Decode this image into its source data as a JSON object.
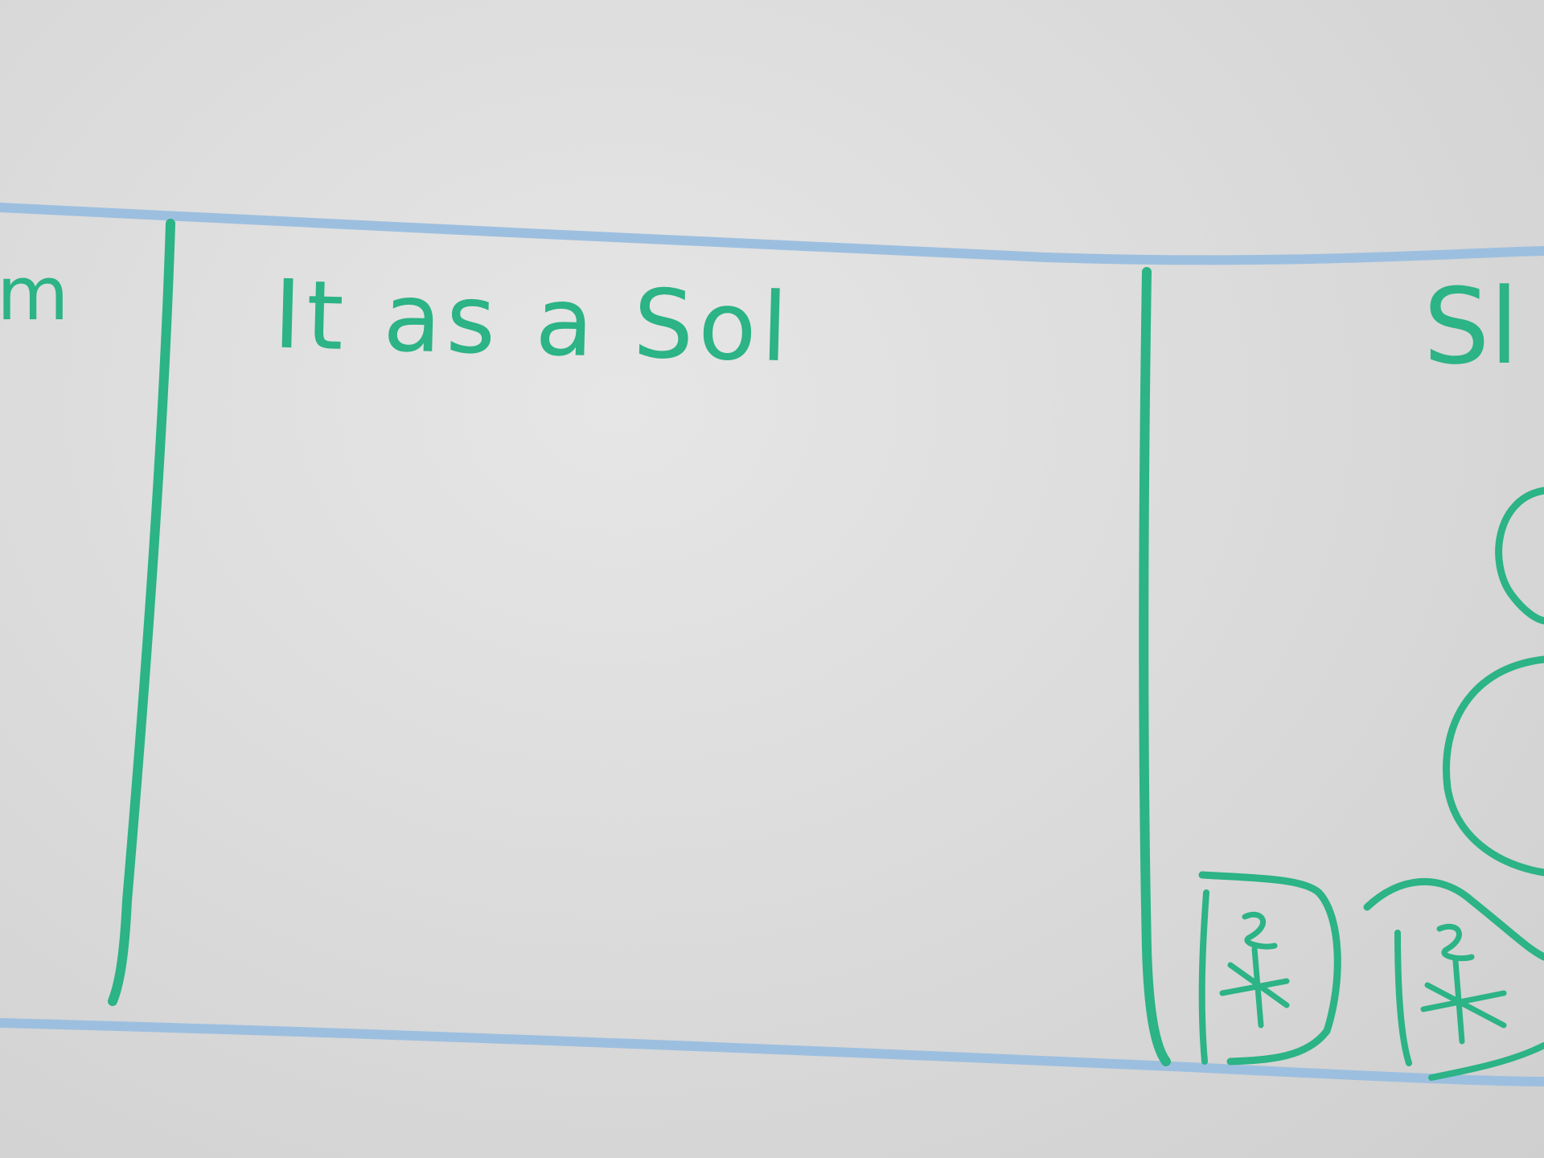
{
  "panel_left": {
    "heading": "m"
  },
  "panel_center": {
    "heading": "It as a Sol"
  },
  "panel_right": {
    "heading": "Sl"
  },
  "colors": {
    "marker_green": "#2cb386",
    "guide_blue": "#9dbfdf",
    "whiteboard": "#dcdcdc"
  },
  "icons": [
    "stick-figure-icon",
    "stick-figure-icon"
  ]
}
